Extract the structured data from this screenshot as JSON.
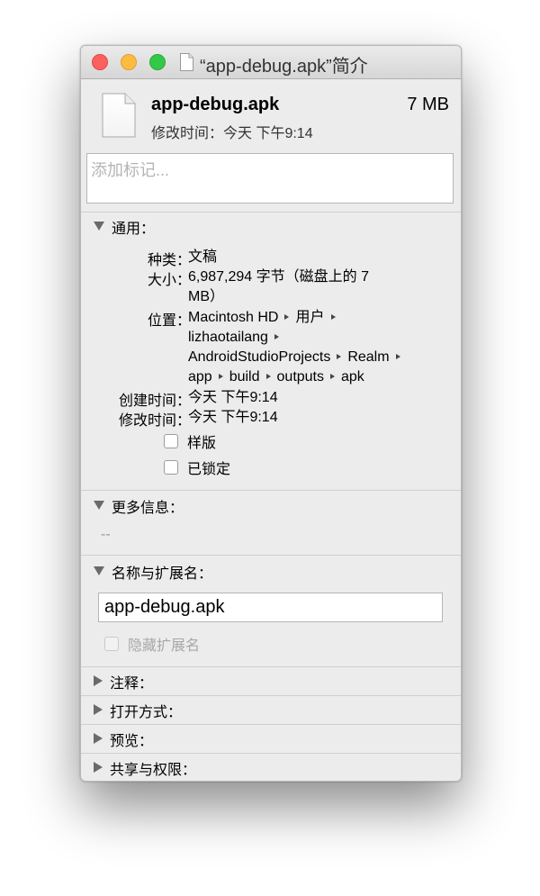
{
  "window": {
    "title": "“app-debug.apk”简介"
  },
  "header": {
    "file_name": "app-debug.apk",
    "file_size": "7 MB",
    "modified": "修改时间：今天 下午9:14"
  },
  "tags": {
    "placeholder": "添加标记..."
  },
  "general": {
    "label": "通用：",
    "kind_label": "种类：",
    "kind_value": "文稿",
    "size_label": "大小：",
    "size_value_line1": "6,987,294 字节（磁盘上的 7",
    "size_value_line2": "MB）",
    "where_label": "位置：",
    "path": [
      "Macintosh HD",
      "用户",
      "lizhaotailang",
      "AndroidStudioProjects",
      "Realm",
      "app",
      "build",
      "outputs",
      "apk"
    ],
    "created_label": "创建时间：",
    "created_value": "今天 下午9:14",
    "modified_label": "修改时间：",
    "modified_value": "今天 下午9:14",
    "stationery_label": "样版",
    "locked_label": "已锁定"
  },
  "more_info": {
    "label": "更多信息：",
    "placeholder": "--"
  },
  "name_ext": {
    "label": "名称与扩展名：",
    "value": "app-debug.apk",
    "hide_ext_label": "隐藏扩展名"
  },
  "comments": {
    "label": "注释："
  },
  "open_with": {
    "label": "打开方式："
  },
  "preview": {
    "label": "预览："
  },
  "sharing": {
    "label": "共享与权限："
  },
  "icons": {
    "close": "close-button",
    "minimize": "minimize-button",
    "zoom": "zoom-button",
    "file": "document-icon",
    "disclosure_open": "disclosure-triangle-down-icon",
    "disclosure_closed": "disclosure-triangle-right-icon",
    "path_separator": "path-separator-icon"
  },
  "colors": {
    "close": "#fc615d",
    "minimize": "#fdbc40",
    "zoom": "#34c84a",
    "window_bg": "#ececec"
  }
}
